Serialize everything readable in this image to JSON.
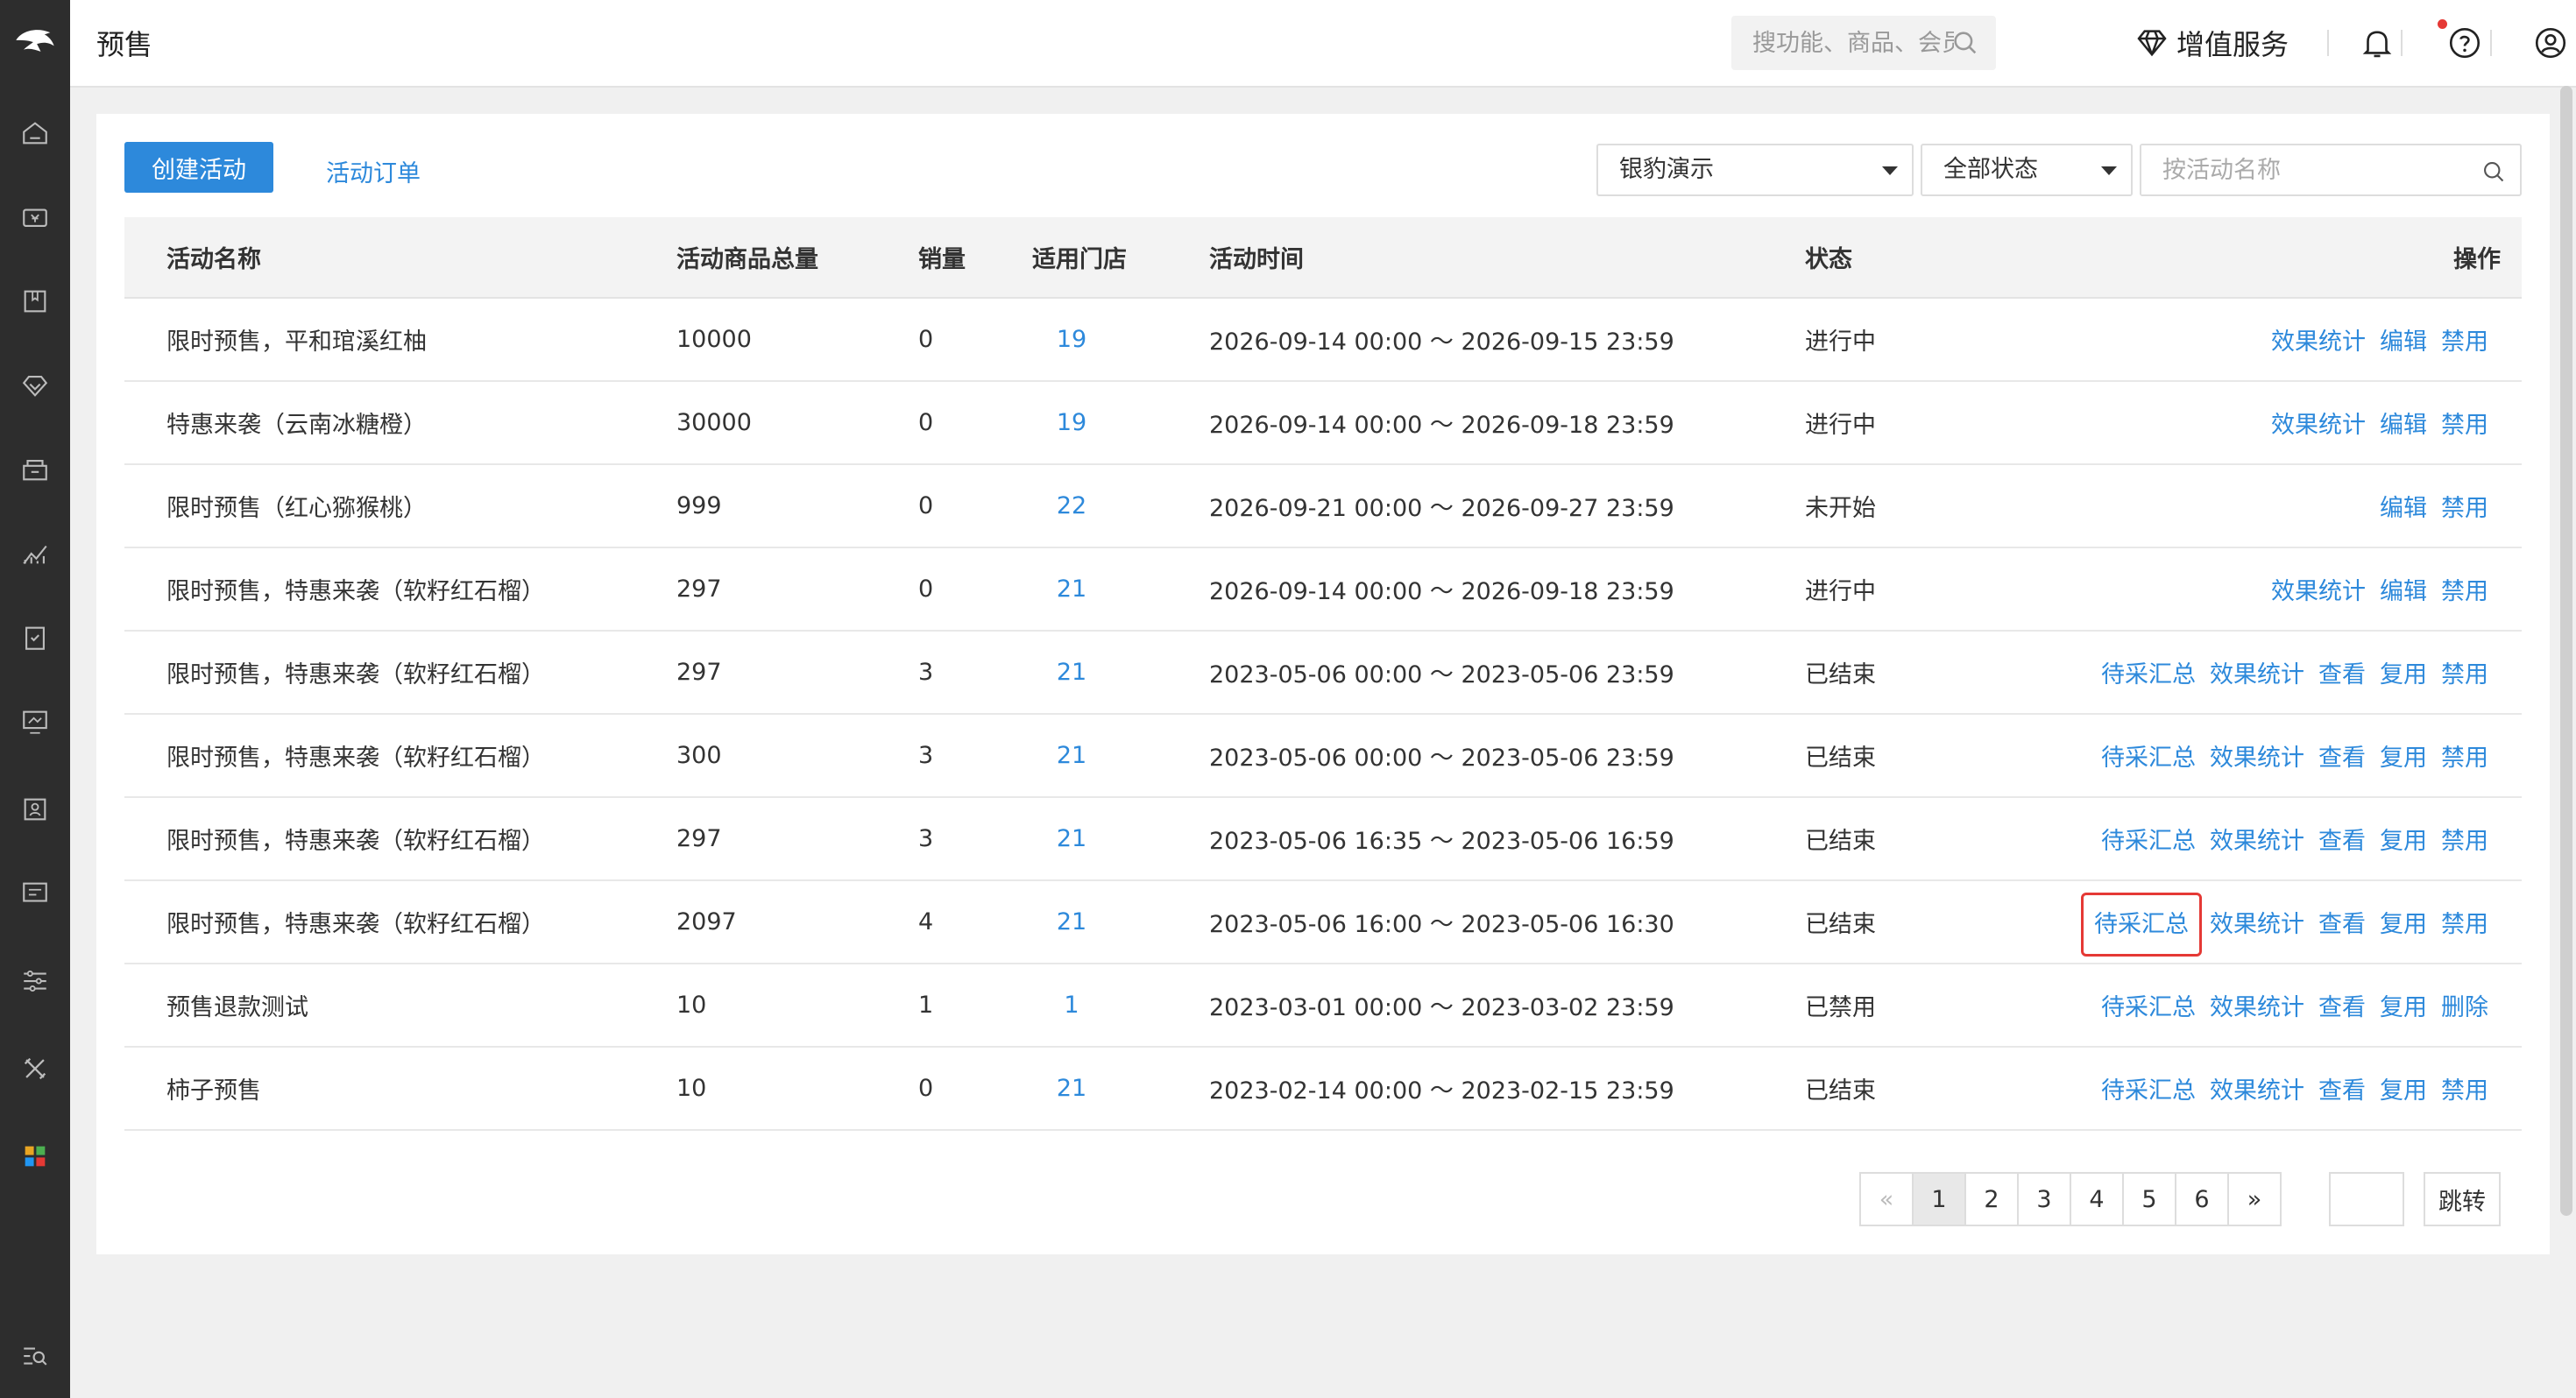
{
  "header": {
    "title": "预售",
    "search_placeholder": "搜功能、商品、会员...",
    "vip_label": "增值服务"
  },
  "sidebar": {
    "icons": [
      "logo-icon",
      "home-icon",
      "wallet-icon",
      "book-icon",
      "diamond-icon",
      "box-icon",
      "chart-icon",
      "clipboard-icon",
      "monitor-icon",
      "id-card-icon",
      "report-icon",
      "sliders-icon",
      "tools-icon",
      "apps-icon",
      "search-list-icon"
    ]
  },
  "toolbar": {
    "create_label": "创建活动",
    "orders_label": "活动订单",
    "store_select": "银豹演示",
    "status_select": "全部状态",
    "name_placeholder": "按活动名称"
  },
  "table": {
    "headers": [
      "活动名称",
      "活动商品总量",
      "销量",
      "适用门店",
      "活动时间",
      "状态",
      "操作"
    ],
    "rows": [
      {
        "name": "限时预售，平和琯溪红柚",
        "total": "10000",
        "sales": "0",
        "stores": "19",
        "time": "2026-09-14 00:00 〜 2026-09-15 23:59",
        "status": "进行中",
        "ops": [
          "效果统计",
          "编辑",
          "禁用"
        ]
      },
      {
        "name": "特惠来袭（云南冰糖橙）",
        "total": "30000",
        "sales": "0",
        "stores": "19",
        "time": "2026-09-14 00:00 〜 2026-09-18 23:59",
        "status": "进行中",
        "ops": [
          "效果统计",
          "编辑",
          "禁用"
        ]
      },
      {
        "name": "限时预售（红心猕猴桃）",
        "total": "999",
        "sales": "0",
        "stores": "22",
        "time": "2026-09-21 00:00 〜 2026-09-27 23:59",
        "status": "未开始",
        "ops": [
          "编辑",
          "禁用"
        ]
      },
      {
        "name": "限时预售，特惠来袭（软籽红石榴）",
        "total": "297",
        "sales": "0",
        "stores": "21",
        "time": "2026-09-14 00:00 〜 2026-09-18 23:59",
        "status": "进行中",
        "ops": [
          "效果统计",
          "编辑",
          "禁用"
        ]
      },
      {
        "name": "限时预售，特惠来袭（软籽红石榴）",
        "total": "297",
        "sales": "3",
        "stores": "21",
        "time": "2023-05-06 00:00 〜 2023-05-06 23:59",
        "status": "已结束",
        "ops": [
          "待采汇总",
          "效果统计",
          "查看",
          "复用",
          "禁用"
        ]
      },
      {
        "name": "限时预售，特惠来袭（软籽红石榴）",
        "total": "300",
        "sales": "3",
        "stores": "21",
        "time": "2023-05-06 00:00 〜 2023-05-06 23:59",
        "status": "已结束",
        "ops": [
          "待采汇总",
          "效果统计",
          "查看",
          "复用",
          "禁用"
        ]
      },
      {
        "name": "限时预售，特惠来袭（软籽红石榴）",
        "total": "297",
        "sales": "3",
        "stores": "21",
        "time": "2023-05-06 16:35 〜 2023-05-06 16:59",
        "status": "已结束",
        "ops": [
          "待采汇总",
          "效果统计",
          "查看",
          "复用",
          "禁用"
        ]
      },
      {
        "name": "限时预售，特惠来袭（软籽红石榴）",
        "total": "2097",
        "sales": "4",
        "stores": "21",
        "time": "2023-05-06 16:00 〜 2023-05-06 16:30",
        "status": "已结束",
        "ops": [
          "待采汇总",
          "效果统计",
          "查看",
          "复用",
          "禁用"
        ],
        "highlight_op": 0
      },
      {
        "name": "预售退款测试",
        "total": "10",
        "sales": "1",
        "stores": "1",
        "time": "2023-03-01 00:00 〜 2023-03-02 23:59",
        "status": "已禁用",
        "ops": [
          "待采汇总",
          "效果统计",
          "查看",
          "复用",
          "删除"
        ]
      },
      {
        "name": "柿子预售",
        "total": "10",
        "sales": "0",
        "stores": "21",
        "time": "2023-02-14 00:00 〜 2023-02-15 23:59",
        "status": "已结束",
        "ops": [
          "待采汇总",
          "效果统计",
          "查看",
          "复用",
          "禁用"
        ]
      }
    ]
  },
  "pagination": {
    "prev": "«",
    "pages": [
      "1",
      "2",
      "3",
      "4",
      "5",
      "6"
    ],
    "next": "»",
    "current": "1",
    "jump_label": "跳转"
  },
  "colors": {
    "accent": "#2d89db",
    "sidebar": "#2d2d2d",
    "highlight": "#e53935"
  }
}
